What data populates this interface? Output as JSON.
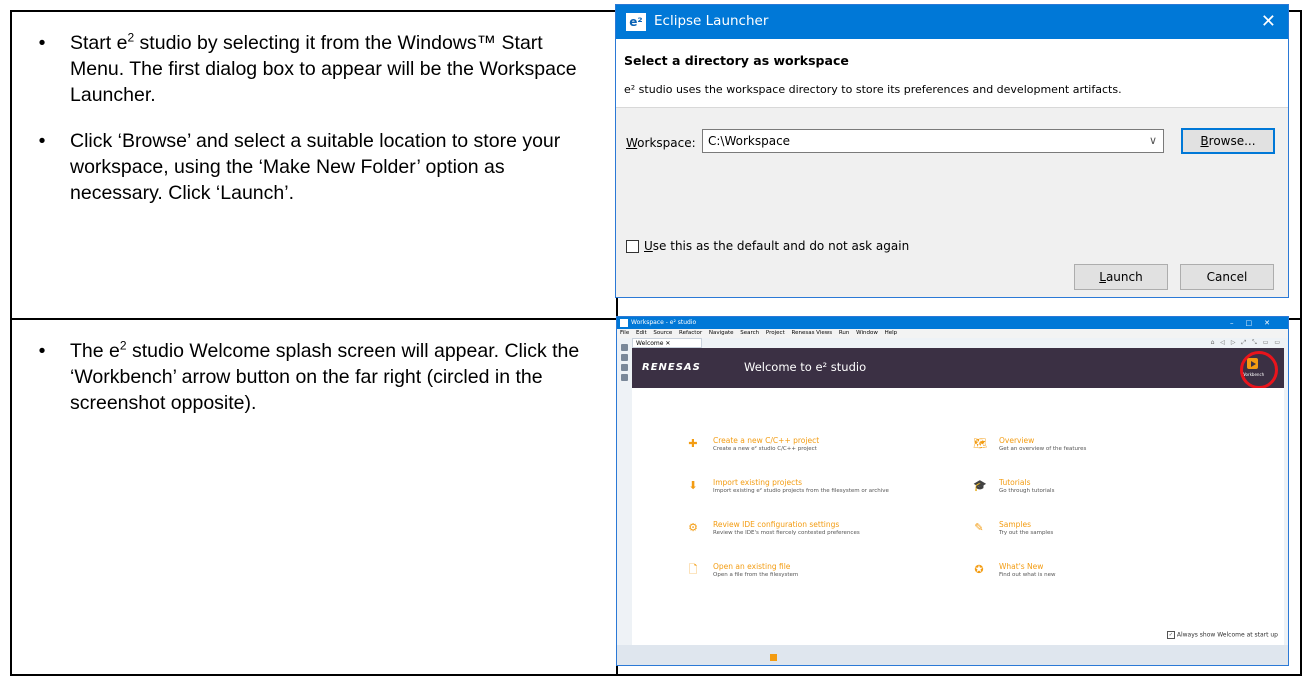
{
  "instructions": [
    {
      "segments": [
        {
          "t": "Start e"
        },
        {
          "t": "2",
          "sup": true
        },
        {
          "t": " studio by selecting it from the Windows™ Start Menu.  The first dialog box to appear will be the Workspace Launcher."
        }
      ]
    },
    {
      "segments": [
        {
          "t": "Click ‘Browse’ and select a suitable location to store your workspace, using the ‘Make New Folder’ option as necessary.  Click ‘Launch’."
        }
      ]
    },
    {
      "segments": [
        {
          "t": "The e"
        },
        {
          "t": "2",
          "sup": true
        },
        {
          "t": " studio Welcome splash screen will appear.  Click the ‘Workbench’ arrow button on the far right (circled in the screenshot opposite)."
        }
      ]
    }
  ],
  "bullet_char": "•",
  "launcher": {
    "title": "Eclipse Launcher",
    "logo": "e²",
    "close_icon": "✕",
    "heading": "Select a directory as workspace",
    "description": "e² studio uses the workspace directory to store its preferences and development artifacts.",
    "workspace_label_u": "W",
    "workspace_label_rest": "orkspace:",
    "workspace_value": "C:\\Workspace",
    "browse_u": "B",
    "browse_rest": "rowse...",
    "default_checkbox_u": "U",
    "default_checkbox_rest": "se this as the default and do not ask again",
    "launch_u": "L",
    "launch_rest": "aunch",
    "cancel": "Cancel"
  },
  "welcome_window": {
    "title": "Workspace - e² studio",
    "window_controls": "–□✕",
    "menu": [
      "File",
      "Edit",
      "Source",
      "Refactor",
      "Navigate",
      "Search",
      "Project",
      "Renesas Views",
      "Run",
      "Window",
      "Help"
    ],
    "tab": "Welcome ✕",
    "brand": "RENESAS",
    "heading": "Welcome to e² studio",
    "workbench_label": "Workbench",
    "items_left": [
      {
        "icon": "plus-circle-icon",
        "glyph": "✚",
        "title": "Create a new C/C++ project",
        "sub": "Create a new e² studio C/C++ project"
      },
      {
        "icon": "import-icon",
        "glyph": "⬇",
        "title": "Import existing projects",
        "sub": "Import existing e² studio projects from the filesystem or archive"
      },
      {
        "icon": "gear-icon",
        "glyph": "⚙",
        "title": "Review IDE configuration settings",
        "sub": "Review the IDE's most fiercely contested preferences"
      },
      {
        "icon": "file-icon",
        "glyph": "🗋",
        "title": "Open an existing file",
        "sub": "Open a file from the filesystem"
      }
    ],
    "items_right": [
      {
        "icon": "map-icon",
        "glyph": "🗺",
        "title": "Overview",
        "sub": "Get an overview of the features"
      },
      {
        "icon": "graduation-cap-icon",
        "glyph": "🎓",
        "title": "Tutorials",
        "sub": "Go through tutorials"
      },
      {
        "icon": "magic-wand-icon",
        "glyph": "✎",
        "title": "Samples",
        "sub": "Try out the samples"
      },
      {
        "icon": "star-circle-icon",
        "glyph": "✪",
        "title": "What's New",
        "sub": "Find out what is new"
      }
    ],
    "always_show": "Always show Welcome at start up"
  }
}
